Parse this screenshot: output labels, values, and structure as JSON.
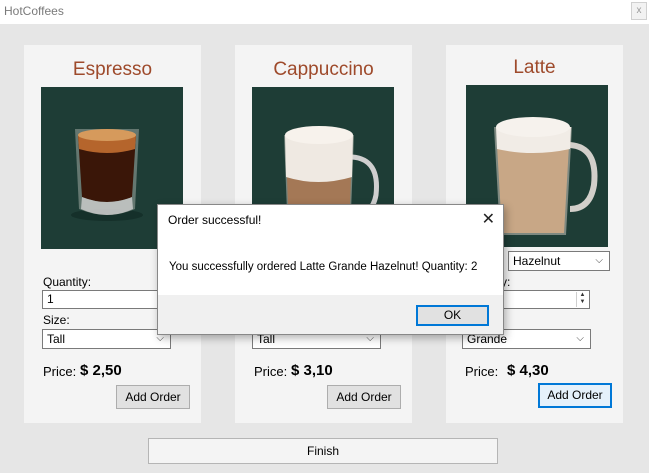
{
  "window": {
    "title": "HotCoffees",
    "close_glyph": "x"
  },
  "colors": {
    "product_name": "#9e4a2b",
    "photo_bg": "#1e3d36",
    "focus_border": "#0078d7"
  },
  "products": [
    {
      "name": "Espresso",
      "quantity_label": "Quantity:",
      "quantity_value": "1",
      "size_label": "Size:",
      "size_value": "Tall",
      "price_label": "Price:",
      "price_value": "$  2,50",
      "add_label": "Add Order"
    },
    {
      "name": "Cappuccino",
      "size_value": "Tall",
      "price_label": "Price:",
      "price_value": "$  3,10",
      "add_label": "Add Order"
    },
    {
      "name": "Latte",
      "flavor_value": "Hazelnut",
      "quantity_label_partial": "y:",
      "size_value": "Grande",
      "price_label": "Price:",
      "price_value": "$ 4,30",
      "add_label": "Add Order"
    }
  ],
  "finish_label": "Finish",
  "dialog": {
    "title": "Order successful!",
    "message": "You successfully ordered Latte Grande Hazelnut! Quantity: 2",
    "ok_label": "OK",
    "close_glyph": "✕"
  }
}
